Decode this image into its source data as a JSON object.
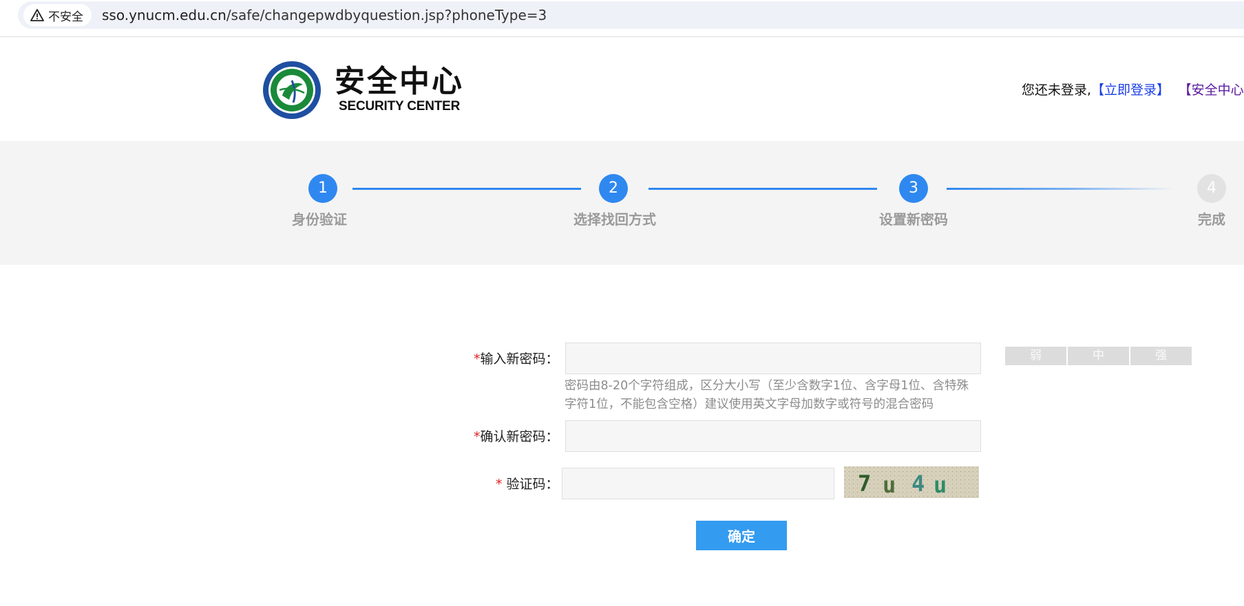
{
  "browser": {
    "security_label": "不安全",
    "url_host": "sso.ynucm.edu.cn",
    "url_path": "/safe/changepwdbyquestion.jsp?phoneType=3"
  },
  "header": {
    "logo_title": "安全中心",
    "logo_subtitle": "SECURITY CENTER",
    "not_logged_in": "您还未登录,",
    "login_link": "【立即登录】",
    "security_center_link": "【安全中心"
  },
  "steps": [
    {
      "number": "1",
      "label": "身份验证",
      "state": "done"
    },
    {
      "number": "2",
      "label": "选择找回方式",
      "state": "done"
    },
    {
      "number": "3",
      "label": "设置新密码",
      "state": "current"
    },
    {
      "number": "4",
      "label": "完成",
      "state": "todo"
    }
  ],
  "form": {
    "required_mark": "*",
    "new_password_label": "输入新密码：",
    "new_password_value": "",
    "password_hint": "密码由8-20个字符组成，区分大小写（至少含数字1位、含字母1位、含特殊字符1位，不能包含空格）建议使用英文字母加数字或符号的混合密码",
    "confirm_password_label": "确认新密码：",
    "confirm_password_value": "",
    "captcha_label": " 验证码：",
    "captcha_value": "",
    "captcha_text": "7u4u",
    "submit_label": "确定"
  },
  "strength_meter": {
    "levels": [
      "弱",
      "中",
      "强"
    ]
  },
  "colors": {
    "accent": "#2f88f0",
    "button": "#339bf0",
    "required": "#e02020",
    "link": "#1a3ee8"
  }
}
